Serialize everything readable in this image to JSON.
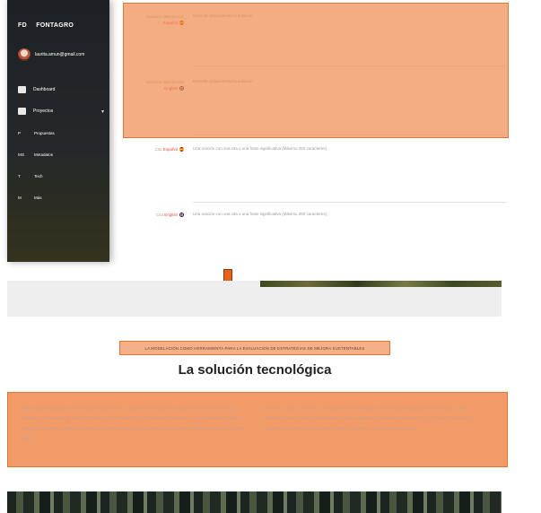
{
  "sidebar": {
    "brand_short": "FD",
    "brand_name": "FONTAGRO",
    "user_email": "laurita.amun@gmail.com",
    "items": [
      {
        "label": "Dashboard",
        "icon": "dashboard-icon"
      },
      {
        "label": "Proyectos",
        "icon": "folder-icon",
        "caret": "▾"
      }
    ],
    "sub_items": [
      {
        "abbr": "P",
        "label": "Propuestas"
      },
      {
        "abbr": "MG",
        "label": "Metadatos"
      },
      {
        "abbr": "T",
        "label": "Tech"
      },
      {
        "abbr": "M",
        "label": "Más"
      }
    ]
  },
  "form": {
    "fields": [
      {
        "label": "Solución Descripción",
        "lang": "Español",
        "placeholder": "Describe propiamente la solución"
      },
      {
        "label": "Solución Descripción",
        "lang": "English",
        "placeholder": "Describe propiamente la solución"
      },
      {
        "label": "Cita",
        "lang": "Español",
        "placeholder": "Una oración con una cita o una frase significativa (Máximo 250 caracteres)"
      },
      {
        "label": "Cita",
        "lang": "English",
        "placeholder": "Una oración con una cita o una frase significativa (Máximo 250 caracteres)"
      }
    ]
  },
  "page": {
    "tagline": "LA MODELACIÓN COMO HERRAMIENTA PARA LA EVALUACIÓN DE ESTRATEGIAS DE MEJORA SUSTENTABLES",
    "section_title": "La solución tecnológica",
    "paragraph_left": "Para evaluar estrategias de intensificación sustentables, se desarrolló el \"Modelo de Simulación de Sistemas Lecheros\" adaptado a los sistemas de producción lechero de toda la región. Esta herramienta permitió, con pocos datos de entrada y sencillos de obtener, modelizar los sistemas de base de cada país y consensuar propuestas de mejora, evaluando el impacto físico,",
    "paragraph_right": "económico, social y ambiental. La validación de las estrategias de intensificación sustentables se realizará en fincas comerciales en las cuales se implementará el cambio planificado mediante la intervención de un técnico facilitador, se compartirá el proceso de aprendizaje con otros y se darán a conocer los aprendizajes."
  },
  "colors": {
    "highlight": "#f0894f",
    "arrow": "#e8621c",
    "sidebar_bg": "#1d2126",
    "lang_red": "#e24545"
  }
}
